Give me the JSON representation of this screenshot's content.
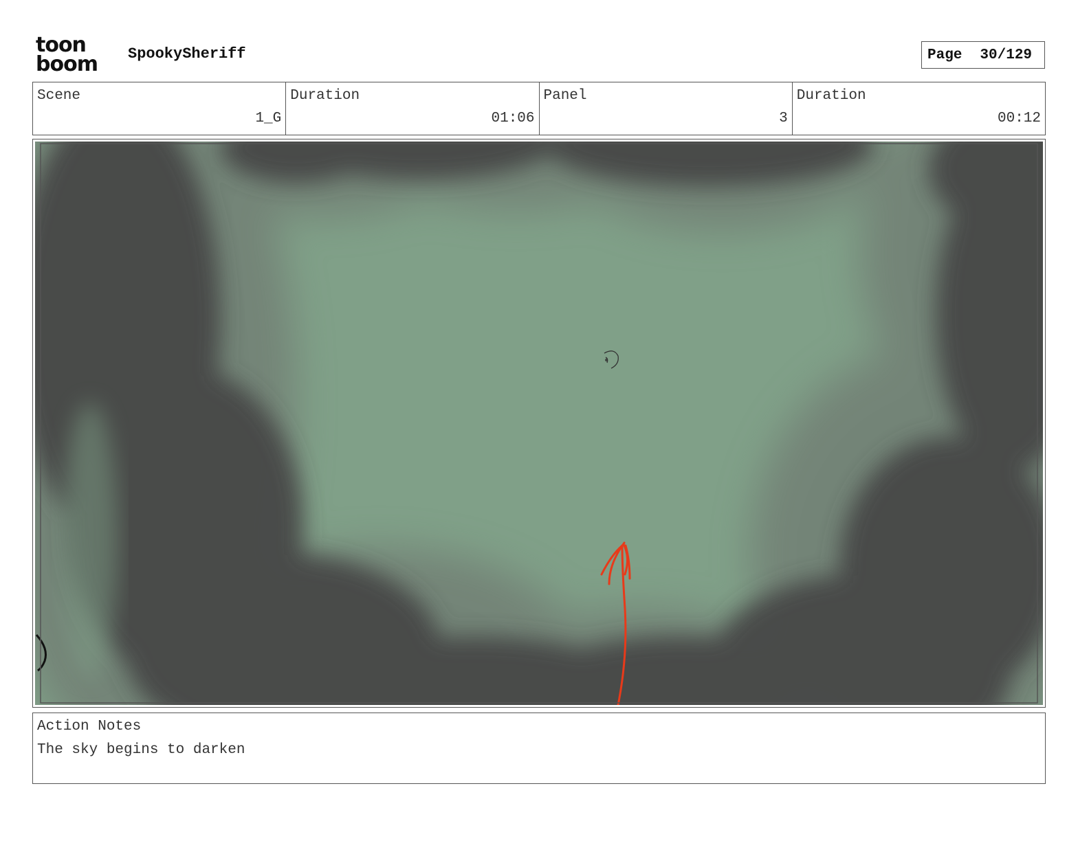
{
  "header": {
    "logo_line1": "toon",
    "logo_line2": "boom",
    "project_title": "SpookySheriff",
    "page_label": "Page",
    "page_value": "30/129"
  },
  "info": {
    "scene_label": "Scene",
    "scene_value": "1_G",
    "scene_duration_label": "Duration",
    "scene_duration_value": "01:06",
    "panel_label": "Panel",
    "panel_value": "3",
    "panel_duration_label": "Duration",
    "panel_duration_value": "00:12"
  },
  "panel": {
    "sky_color": "#80a088",
    "cloud_color": "#444444",
    "arrow_color": "#e83a1a"
  },
  "notes": {
    "label": "Action Notes",
    "text": "The sky begins to darken"
  }
}
